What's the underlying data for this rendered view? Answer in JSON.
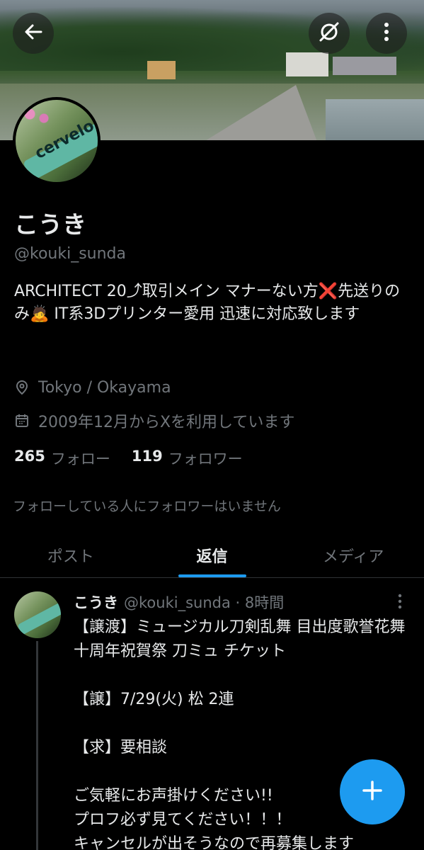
{
  "header": {
    "icons": {
      "back": "arrow-left-icon",
      "grok": "grok-icon",
      "more": "more-vertical-icon"
    }
  },
  "profile": {
    "name": "こうき",
    "handle": "@kouki_sunda",
    "bio": "ARCHITECT 20⤴取引メイン マナーない方❌先送りのみ🙇 IT系3Dプリンター愛用 迅速に対応致します",
    "location": "Tokyo / Okayama",
    "joined": "2009年12月からXを利用しています",
    "following_count": "265",
    "following_label": "フォロー",
    "followers_count": "119",
    "followers_label": "フォロワー",
    "mutual_note": "フォローしている人にフォロワーはいません"
  },
  "tabs": [
    {
      "label": "ポスト",
      "active": false
    },
    {
      "label": "返信",
      "active": true
    },
    {
      "label": "メディア",
      "active": false
    }
  ],
  "post": {
    "name": "こうき",
    "handle_time": "@kouki_sunda · 8時間",
    "body": "【譲渡】ミュージカル刀剣乱舞 目出度歌誉花舞 十周年祝賀祭 刀ミュ チケット\n\n【譲】7/29(火) 松 2連\n\n【求】要相談\n\nご気軽にお声掛けください!!\nプロフ必ず見てください！！！\nキャンセルが出そうなので再募集します"
  },
  "colors": {
    "background": "#000000",
    "accent": "#1d9bf0",
    "text_primary": "#e7e9ea",
    "text_secondary": "#71767b"
  },
  "fab": {
    "icon": "plus-icon"
  }
}
